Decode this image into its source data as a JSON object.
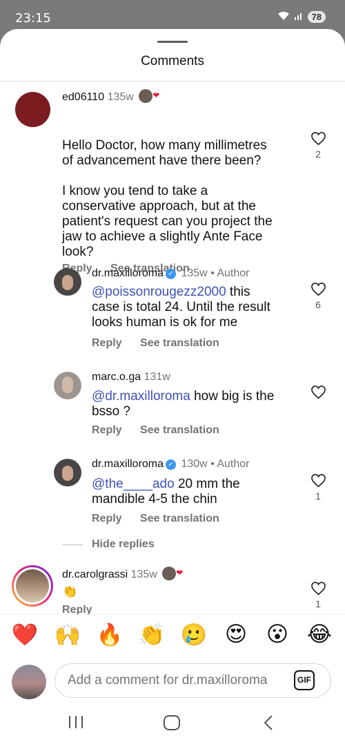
{
  "status": {
    "time": "23:15",
    "battery": "78"
  },
  "sheet": {
    "title": "Comments"
  },
  "comments": [
    {
      "username": "ed06110",
      "age": "135w",
      "text": [
        "Hello Doctor, how many millimetres",
        "of advancement have there been?",
        "",
        "I know you tend to take a",
        "conservative approach, but at the",
        "patient's request can you project the",
        "jaw to achieve a slightly Ante Face",
        "look?"
      ],
      "reply": "Reply",
      "see_translation": "See translation",
      "likes": "2"
    },
    {
      "username": "dr.maxilloroma",
      "age": "135w",
      "role": "Author",
      "mention": "@poissonrougezz2000",
      "text_after_mention": " this",
      "text": [
        "case is total 24. Until the result",
        "looks human is ok for me"
      ],
      "reply": "Reply",
      "see_translation": "See translation",
      "likes": "6"
    },
    {
      "username": "marc.o.ga",
      "age": "131w",
      "mention": "@dr.maxilloroma",
      "text_after_mention": " how big is the",
      "text": [
        "bsso ?"
      ],
      "reply": "Reply",
      "see_translation": "See translation",
      "likes": ""
    },
    {
      "username": "dr.maxilloroma",
      "age": "130w",
      "role": "Author",
      "mention": "@the____ado",
      "text_after_mention": " 20 mm the",
      "text": [
        "mandible 4-5 the chin"
      ],
      "reply": "Reply",
      "see_translation": "See translation",
      "likes": "1"
    },
    {
      "username": "dr.carolgrassi",
      "age": "135w",
      "text": [
        "👏"
      ],
      "reply": "Reply",
      "likes": "1"
    }
  ],
  "hide_replies": "Hide replies",
  "emoji_bar": [
    "❤️",
    "🙌",
    "🔥",
    "👏",
    "🥲",
    "😍",
    "😮",
    "😂"
  ],
  "input": {
    "placeholder": "Add a comment for dr.maxilloroma",
    "gif": "GIF"
  },
  "colors": {
    "mention": "#3f51b5",
    "verified": "#3897f0",
    "heart": "#e8203e"
  }
}
